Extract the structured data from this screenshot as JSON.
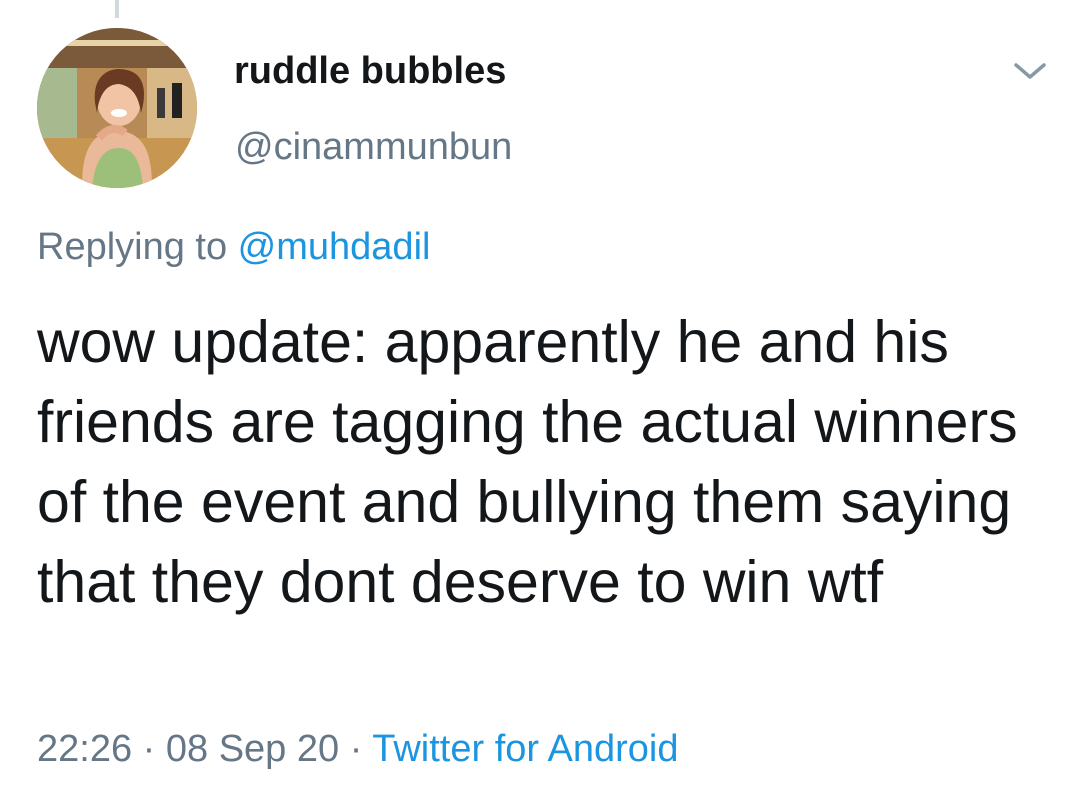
{
  "tweet": {
    "display_name": "ruddle bubbles",
    "handle": "@cinammunbun",
    "replying_prefix": "Replying to ",
    "replying_to": "@muhdadil",
    "text": "wow update: apparently he and his friends are tagging the actual winners of the event and bullying them saying that they dont deserve to win wtf",
    "time": "22:26",
    "separator": " · ",
    "date": "08 Sep 20",
    "source": "Twitter for Android"
  },
  "icons": {
    "menu": "chevron-down-icon",
    "avatar": "profile-photo"
  },
  "colors": {
    "text": "#14171a",
    "secondary": "#657786",
    "link": "#1b95e0"
  }
}
